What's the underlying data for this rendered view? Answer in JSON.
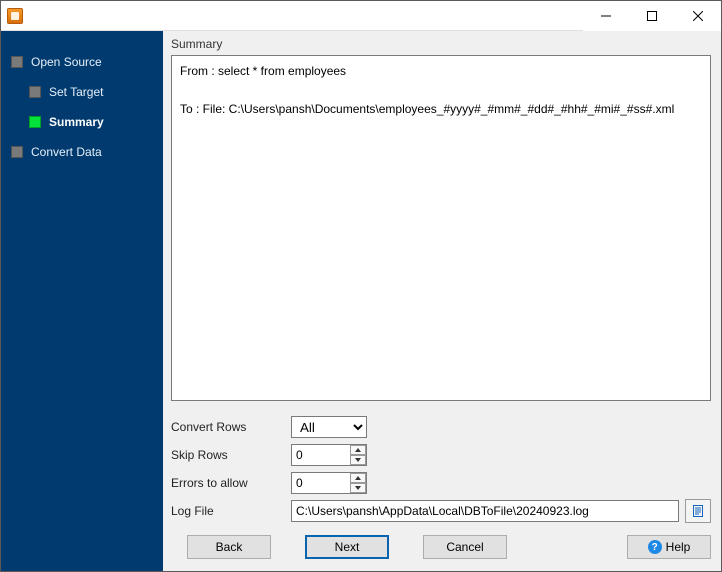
{
  "sidebar": {
    "items": [
      {
        "label": "Open Source",
        "sub": false,
        "current": false
      },
      {
        "label": "Set Target",
        "sub": true,
        "current": false
      },
      {
        "label": "Summary",
        "sub": true,
        "current": true
      },
      {
        "label": "Convert Data",
        "sub": false,
        "current": false
      }
    ]
  },
  "summary": {
    "heading": "Summary",
    "from_line": "From : select * from employees",
    "to_line": "To : File: C:\\Users\\pansh\\Documents\\employees_#yyyy#_#mm#_#dd#_#hh#_#mi#_#ss#.xml"
  },
  "form": {
    "convert_rows": {
      "label": "Convert Rows",
      "value": "All",
      "options": [
        "All"
      ]
    },
    "skip_rows": {
      "label": "Skip Rows",
      "value": "0"
    },
    "errors": {
      "label": "Errors to allow",
      "value": "0"
    },
    "log_file": {
      "label": "Log File",
      "value": "C:\\Users\\pansh\\AppData\\Local\\DBToFile\\20240923.log"
    }
  },
  "buttons": {
    "back": "Back",
    "next": "Next",
    "cancel": "Cancel",
    "help": "Help"
  }
}
